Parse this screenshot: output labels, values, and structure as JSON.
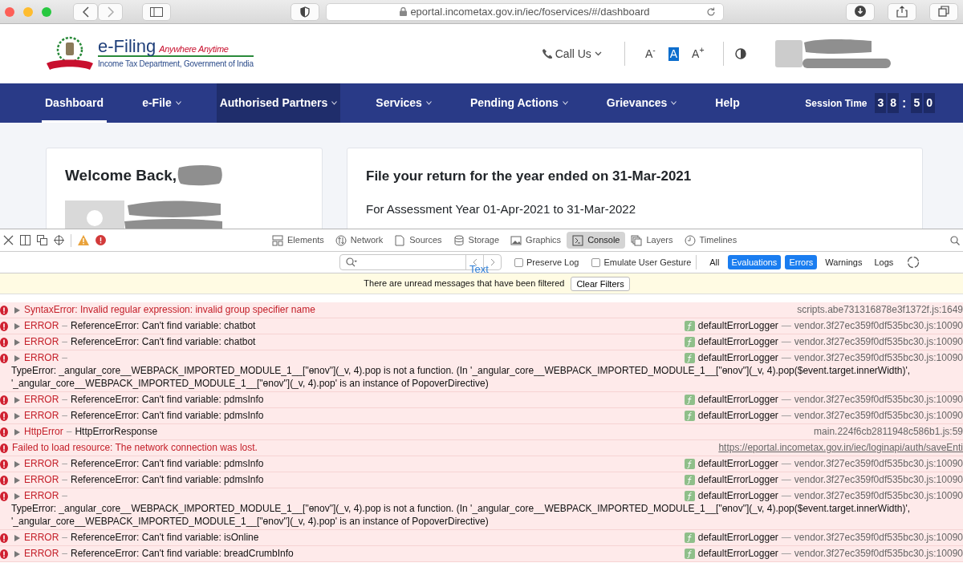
{
  "browser": {
    "url": "eportal.incometax.gov.in/iec/foservices/#/dashboard"
  },
  "site": {
    "brand": "e-Filing",
    "tagline": "Anywhere Anytime",
    "department": "Income Tax Department, Government of India",
    "call_us": "Call Us",
    "font_controls": [
      {
        "label": "A$^{-}$",
        "selected": false
      },
      {
        "label": "A",
        "selected": true
      },
      {
        "label": "A$^{+}$",
        "selected": false
      }
    ]
  },
  "nav": {
    "items": [
      {
        "label": "Dashboard",
        "dropdown": false,
        "selected": true,
        "hovered": false
      },
      {
        "label": "e-File",
        "dropdown": true,
        "selected": false,
        "hovered": false
      },
      {
        "label": "Authorised Partners",
        "dropdown": true,
        "selected": false,
        "hovered": true
      },
      {
        "label": "Services",
        "dropdown": true,
        "selected": false,
        "hovered": false
      },
      {
        "label": "Pending Actions",
        "dropdown": true,
        "selected": false,
        "hovered": false
      },
      {
        "label": "Grievances",
        "dropdown": true,
        "selected": false,
        "hovered": false
      },
      {
        "label": "Help",
        "dropdown": false,
        "selected": false,
        "hovered": false
      }
    ],
    "session": {
      "label": "Session Time",
      "minutes": [
        "3",
        "8"
      ],
      "separator": ":",
      "seconds": [
        "5",
        "0"
      ]
    }
  },
  "welcome_card": {
    "greeting": "Welcome Back,"
  },
  "return_card": {
    "title": "File your return for the year ended on 31-Mar-2021",
    "subtitle": "For Assessment Year 01-Apr-2021 to 31-Mar-2022"
  },
  "devtools": {
    "tabs": [
      {
        "label": "Elements",
        "kind": "elements",
        "selected": false
      },
      {
        "label": "Network",
        "kind": "network",
        "selected": false
      },
      {
        "label": "Sources",
        "kind": "sources",
        "selected": false
      },
      {
        "label": "Storage",
        "kind": "storage",
        "selected": false
      },
      {
        "label": "Graphics",
        "kind": "graphics",
        "selected": false
      },
      {
        "label": "Console",
        "kind": "console",
        "selected": true
      },
      {
        "label": "Layers",
        "kind": "layers",
        "selected": false
      },
      {
        "label": "Timelines",
        "kind": "timelines",
        "selected": false
      }
    ],
    "options": [
      {
        "label": "Preserve Log",
        "checked": false
      },
      {
        "label": "Emulate User Gesture",
        "checked": false
      }
    ],
    "levels": [
      {
        "label": "All",
        "selected": false
      },
      {
        "label": "Evaluations",
        "selected": true
      },
      {
        "label": "Errors",
        "selected": true
      },
      {
        "label": "Warnings",
        "selected": false
      },
      {
        "label": "Logs",
        "selected": false
      }
    ],
    "banner": {
      "message": "There are unread messages that have been filtered",
      "button": "Clear Filters",
      "overlay": "Text"
    }
  },
  "console": [
    {
      "kind": "exception",
      "expandable": true,
      "message": "SyntaxError: Invalid regular expression: invalid group specifier name",
      "source": "scripts.abe731316878e3f1372f.js:1649"
    },
    {
      "kind": "logged",
      "expandable": true,
      "level": "ERROR",
      "dash": "–",
      "message": "ReferenceError: Can't find variable: chatbot",
      "function": "defaultErrorLogger",
      "source_dash": "—",
      "source": "vendor.3f27ec359f0df535bc30.js:10090"
    },
    {
      "kind": "logged",
      "expandable": true,
      "level": "ERROR",
      "dash": "–",
      "message": "ReferenceError: Can't find variable: chatbot",
      "function": "defaultErrorLogger",
      "source_dash": "—",
      "source": "vendor.3f27ec359f0df535bc30.js:10090"
    },
    {
      "kind": "logged",
      "expandable": true,
      "level": "ERROR",
      "dash": "–",
      "detail": "TypeError: _angular_core__WEBPACK_IMPORTED_MODULE_1__[\"ɵnov\"](_v, 4).pop is not a function. (In '_angular_core__WEBPACK_IMPORTED_MODULE_1__[\"ɵnov\"](_v, 4).pop($event.target.innerWidth)', '_angular_core__WEBPACK_IMPORTED_MODULE_1__[\"ɵnov\"](_v, 4).pop' is an instance of PopoverDirective)",
      "function": "defaultErrorLogger",
      "source_dash": "—",
      "source": "vendor.3f27ec359f0df535bc30.js:10090"
    },
    {
      "kind": "logged",
      "expandable": true,
      "level": "ERROR",
      "dash": "–",
      "message": "ReferenceError: Can't find variable: pdmsInfo",
      "function": "defaultErrorLogger",
      "source_dash": "—",
      "source": "vendor.3f27ec359f0df535bc30.js:10090"
    },
    {
      "kind": "logged",
      "expandable": true,
      "level": "ERROR",
      "dash": "–",
      "message": "ReferenceError: Can't find variable: pdmsInfo",
      "function": "defaultErrorLogger",
      "source_dash": "—",
      "source": "vendor.3f27ec359f0df535bc30.js:10090"
    },
    {
      "kind": "logged",
      "expandable": true,
      "level": "HttpError",
      "dash": "–",
      "message": "HttpErrorResponse",
      "source": "main.224f6cb2811948c586b1.js:59"
    },
    {
      "kind": "resource",
      "expandable": false,
      "message": "Failed to load resource: The network connection was lost.",
      "source": "https://eportal.incometax.gov.in/iec/loginapi/auth/saveEnti"
    },
    {
      "kind": "logged",
      "expandable": true,
      "level": "ERROR",
      "dash": "–",
      "message": "ReferenceError: Can't find variable: pdmsInfo",
      "function": "defaultErrorLogger",
      "source_dash": "—",
      "source": "vendor.3f27ec359f0df535bc30.js:10090"
    },
    {
      "kind": "logged",
      "expandable": true,
      "level": "ERROR",
      "dash": "–",
      "message": "ReferenceError: Can't find variable: pdmsInfo",
      "function": "defaultErrorLogger",
      "source_dash": "—",
      "source": "vendor.3f27ec359f0df535bc30.js:10090"
    },
    {
      "kind": "logged",
      "expandable": true,
      "level": "ERROR",
      "dash": "–",
      "detail": "TypeError: _angular_core__WEBPACK_IMPORTED_MODULE_1__[\"ɵnov\"](_v, 4).pop is not a function. (In '_angular_core__WEBPACK_IMPORTED_MODULE_1__[\"ɵnov\"](_v, 4).pop($event.target.innerWidth)', '_angular_core__WEBPACK_IMPORTED_MODULE_1__[\"ɵnov\"](_v, 4).pop' is an instance of PopoverDirective)",
      "function": "defaultErrorLogger",
      "source_dash": "—",
      "source": "vendor.3f27ec359f0df535bc30.js:10090"
    },
    {
      "kind": "logged",
      "expandable": true,
      "level": "ERROR",
      "dash": "–",
      "message": "ReferenceError: Can't find variable: isOnline",
      "function": "defaultErrorLogger",
      "source_dash": "—",
      "source": "vendor.3f27ec359f0df535bc30.js:10090"
    },
    {
      "kind": "logged",
      "expandable": true,
      "level": "ERROR",
      "dash": "–",
      "message": "ReferenceError: Can't find variable: breadCrumbInfo",
      "function": "defaultErrorLogger",
      "source_dash": "—",
      "source": "vendor.3f27ec359f0df535bc30.js:10090"
    }
  ]
}
